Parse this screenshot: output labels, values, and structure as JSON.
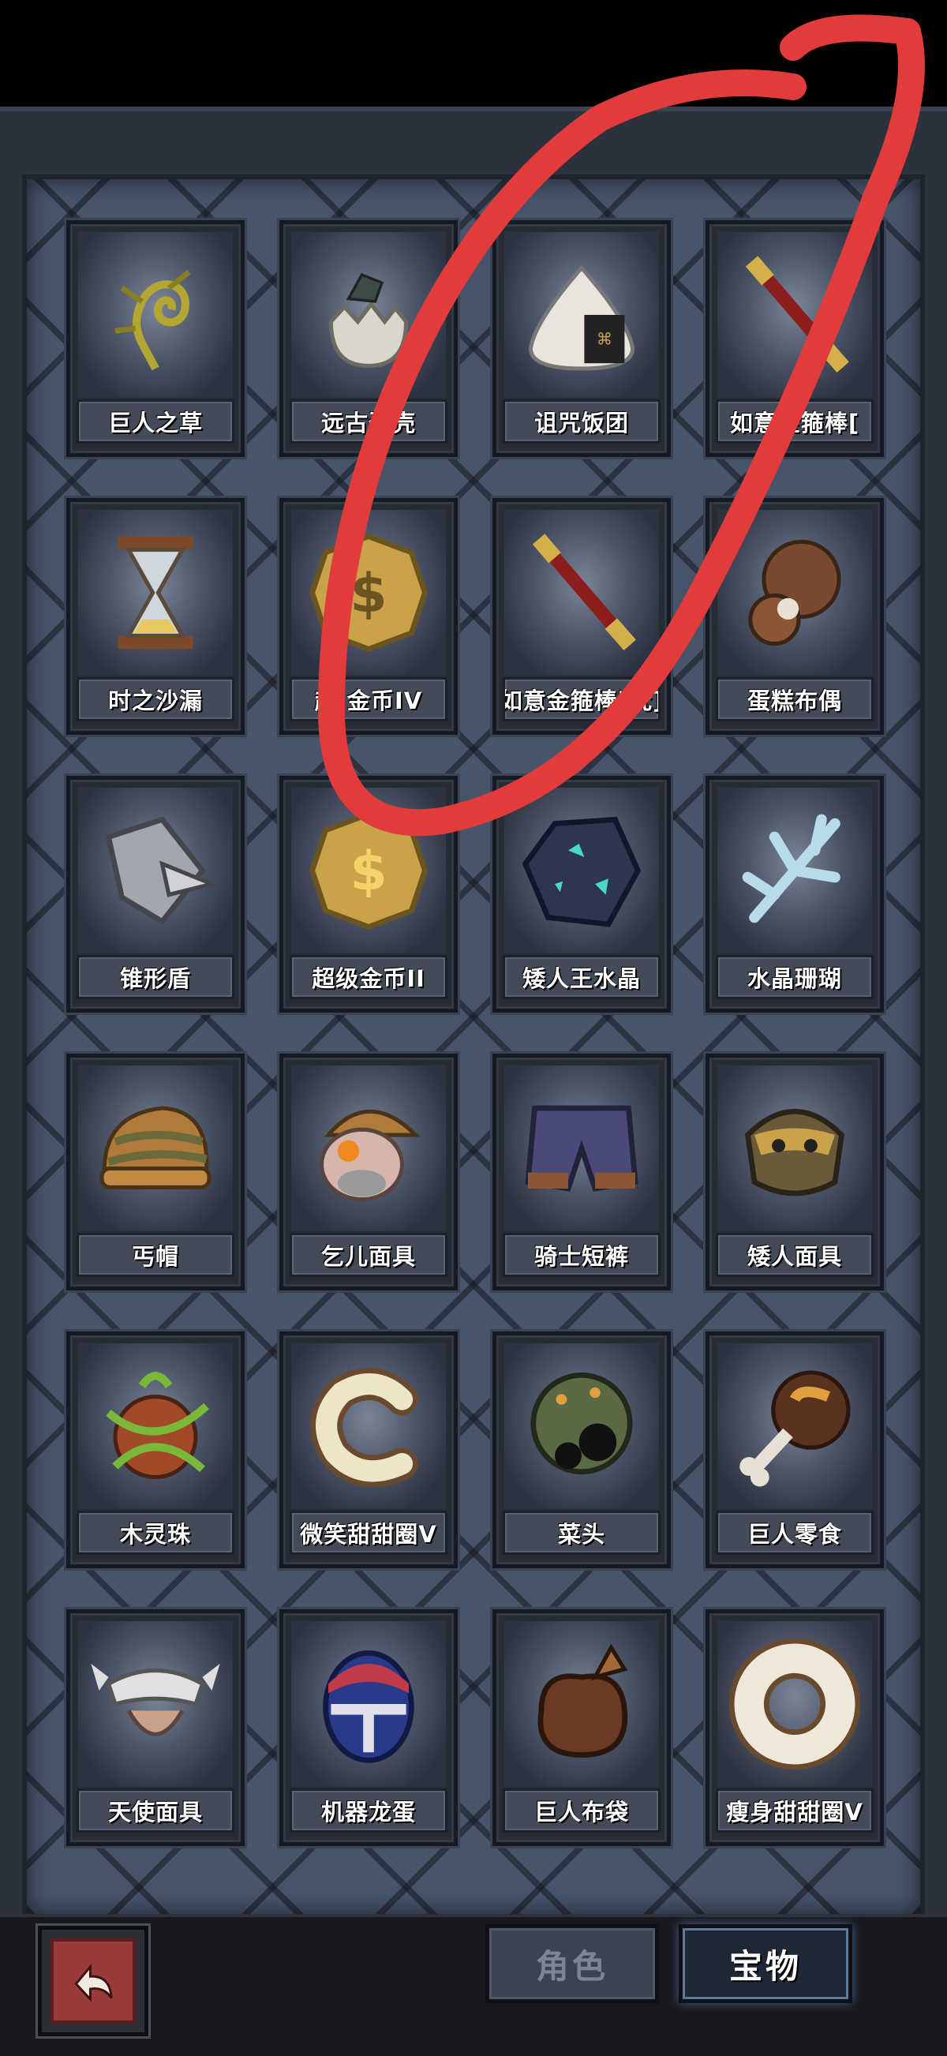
{
  "items": [
    {
      "label": "巨人之草",
      "icon": "vine-icon"
    },
    {
      "label": "远古蛋壳",
      "icon": "eggshell-icon"
    },
    {
      "label": "诅咒饭团",
      "icon": "rice-ball-icon"
    },
    {
      "label": "如意金箍棒[",
      "icon": "staff-icon"
    },
    {
      "label": "时之沙漏",
      "icon": "hourglass-icon"
    },
    {
      "label": "超 金币IV",
      "icon": "gold-coin-icon"
    },
    {
      "label": "如意金箍棒[梵]",
      "icon": "staff-icon"
    },
    {
      "label": "蛋糕布偶",
      "icon": "cake-doll-icon"
    },
    {
      "label": "锥形盾",
      "icon": "cone-shield-icon"
    },
    {
      "label": "超级金币II",
      "icon": "gold-coin-icon"
    },
    {
      "label": "矮人王水晶",
      "icon": "dark-crystal-icon"
    },
    {
      "label": "水晶珊瑚",
      "icon": "crystal-coral-icon"
    },
    {
      "label": "丐帽",
      "icon": "beanie-icon"
    },
    {
      "label": "乞儿面具",
      "icon": "beggar-mask-icon"
    },
    {
      "label": "骑士短裤",
      "icon": "shorts-icon"
    },
    {
      "label": "矮人面具",
      "icon": "dwarf-mask-icon"
    },
    {
      "label": "木灵珠",
      "icon": "wood-orb-icon"
    },
    {
      "label": "微笑甜甜圈V",
      "icon": "donut-c-icon"
    },
    {
      "label": "菜头",
      "icon": "veggie-head-icon"
    },
    {
      "label": "巨人零食",
      "icon": "meat-bone-icon"
    },
    {
      "label": "天使面具",
      "icon": "angel-mask-icon"
    },
    {
      "label": "机器龙蛋",
      "icon": "robot-egg-icon"
    },
    {
      "label": "巨人布袋",
      "icon": "sack-icon"
    },
    {
      "label": "瘦身甜甜圈V",
      "icon": "donut-icon"
    }
  ],
  "tabs": {
    "role": "角色",
    "treasure": "宝物",
    "active": "treasure"
  },
  "colors": {
    "panel": "#47546a",
    "card": "#262b36",
    "annotation": "#e23b3b",
    "back_button": "#9a3b3b",
    "coin": "#c9a24a"
  }
}
